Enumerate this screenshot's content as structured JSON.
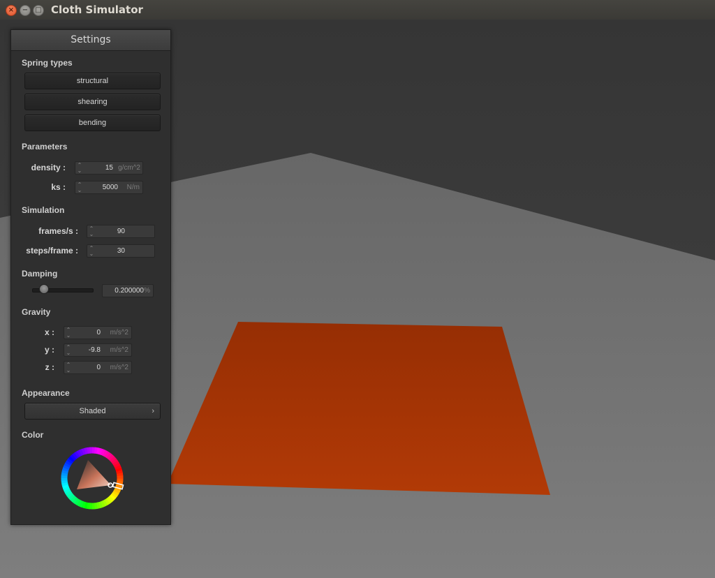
{
  "window": {
    "title": "Cloth Simulator",
    "controls": {
      "close": "×",
      "minimize": "−",
      "maximize": "□"
    }
  },
  "panel": {
    "title": "Settings",
    "spring_types": {
      "label": "Spring types",
      "buttons": [
        "structural",
        "shearing",
        "bending"
      ]
    },
    "parameters": {
      "label": "Parameters",
      "density": {
        "label": "density :",
        "value": "15",
        "unit": "g/cm^2"
      },
      "ks": {
        "label": "ks :",
        "value": "5000",
        "unit": "N/m"
      }
    },
    "simulation": {
      "label": "Simulation",
      "fps": {
        "label": "frames/s :",
        "value": "90"
      },
      "steps": {
        "label": "steps/frame :",
        "value": "30"
      }
    },
    "damping": {
      "label": "Damping",
      "slider_level": 0.2,
      "value": "0.200000",
      "unit": "%"
    },
    "gravity": {
      "label": "Gravity",
      "x": {
        "label": "x :",
        "value": "0",
        "unit": "m/s^2"
      },
      "y": {
        "label": "y :",
        "value": "-9.8",
        "unit": "m/s^2"
      },
      "z": {
        "label": "z :",
        "value": "0",
        "unit": "m/s^2"
      }
    },
    "appearance": {
      "label": "Appearance",
      "selected": "Shaded",
      "chevron": "›"
    },
    "color": {
      "label": "Color",
      "current": "#c84418"
    }
  },
  "scene": {
    "cloth_color": "#a03004",
    "floor_color": "#6e6e6e",
    "wall_color": "#3c3c3c"
  }
}
